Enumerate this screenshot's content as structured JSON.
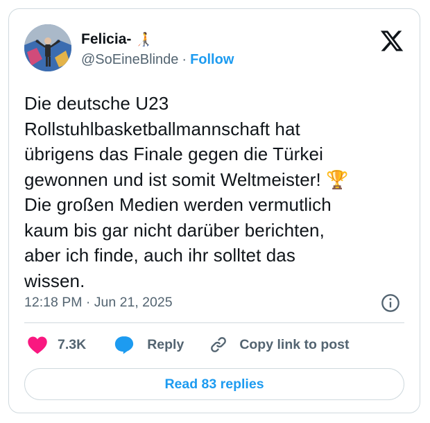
{
  "author": {
    "display_name": "Felicia-",
    "name_emoji": "🧑‍🦯",
    "handle": "@SoEineBlinde",
    "separator": "·",
    "follow_label": "Follow"
  },
  "tweet": {
    "text": "Die deutsche U23\nRollstuhlbasketballmannschaft hat\nübrigens das Finale gegen die Türkei\ngewonnen und ist somit Weltmeister! 🏆\nDie großen Medien werden vermutlich\nkaum bis gar nicht darüber berichten,\naber ich finde, auch ihr solltet das\nwissen.",
    "timestamp": "12:18 PM · Jun 21, 2025"
  },
  "actions": {
    "like_count": "7.3K",
    "reply_label": "Reply",
    "copy_link_label": "Copy link to post"
  },
  "read_replies_label": "Read 83 replies",
  "icons": {
    "logo": "x-logo-icon",
    "info": "info-icon",
    "like": "heart-icon",
    "reply": "speech-bubble-icon",
    "copy": "link-icon"
  },
  "colors": {
    "accent": "#1d9bf0",
    "like": "#f91880",
    "text": "#0f1419",
    "secondary": "#536471",
    "border": "#cfd9de"
  }
}
